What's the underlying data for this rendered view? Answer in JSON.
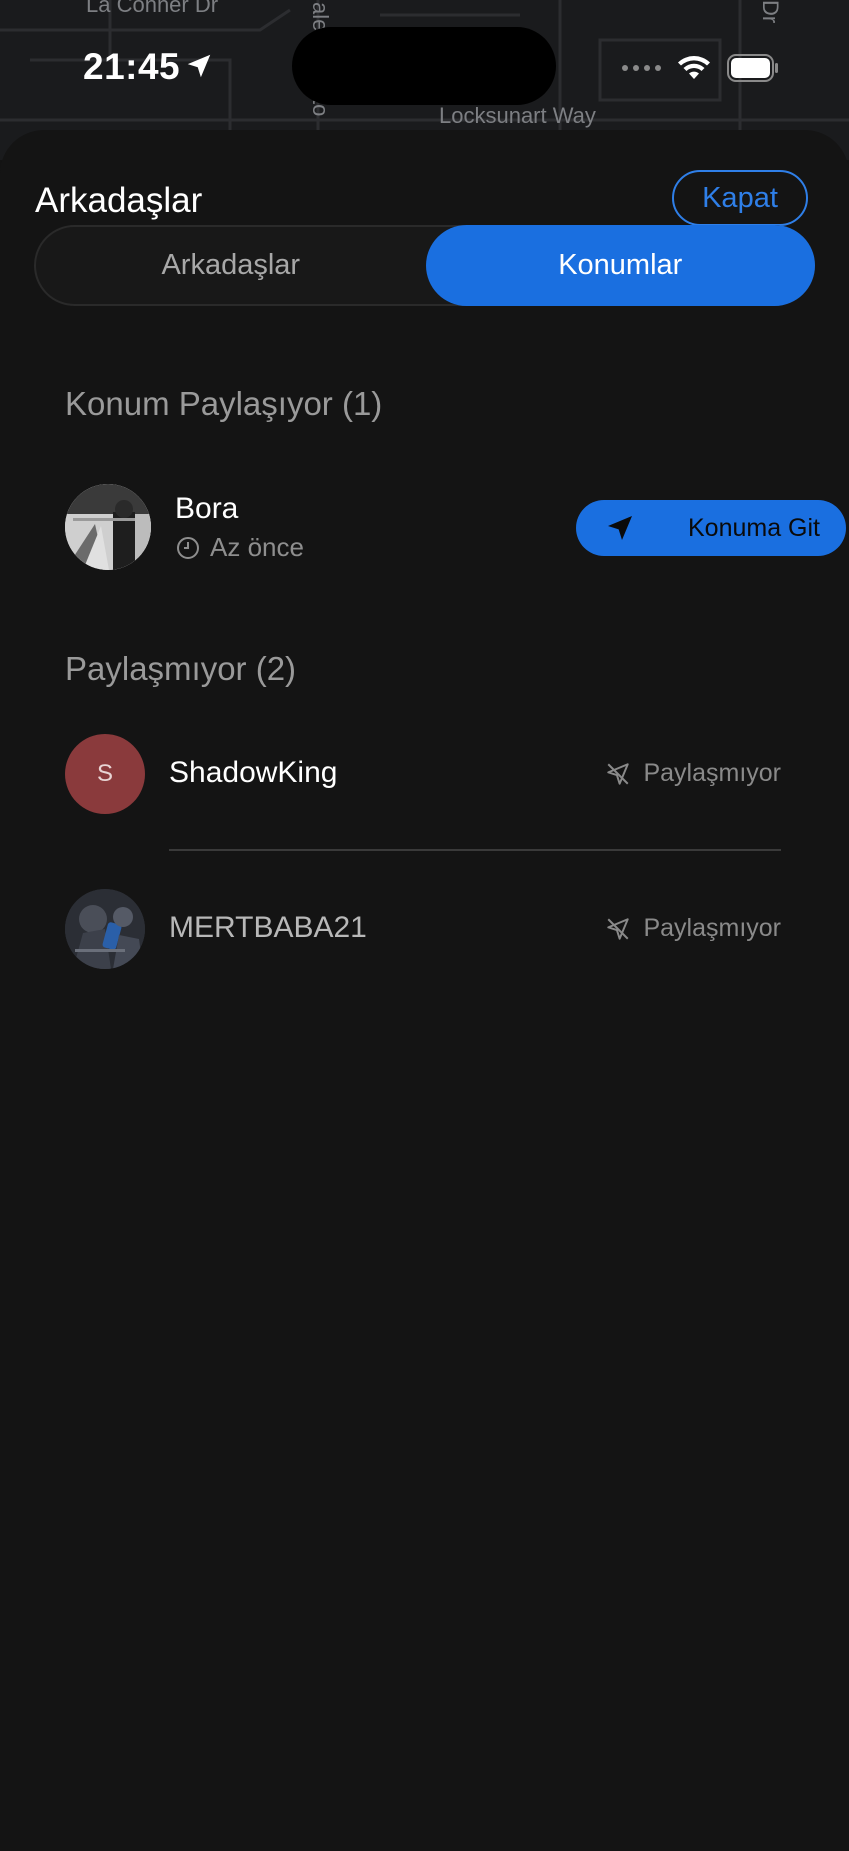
{
  "map": {
    "labels": {
      "top_left": "La Conner Dr",
      "bottom": "Locksunart Way",
      "vertical_1": "ale",
      "vertical_2": "to",
      "vertical_right": "Dr"
    }
  },
  "status_bar": {
    "time": "21:45",
    "location_icon": "location-arrow-icon",
    "cellular_icon": "cellular-dots-icon",
    "wifi_icon": "wifi-icon",
    "battery_icon": "battery-icon"
  },
  "sheet": {
    "title": "Arkadaşlar",
    "close_label": "Kapat",
    "tabs": [
      {
        "label": "Arkadaşlar",
        "active": false
      },
      {
        "label": "Konumlar",
        "active": true
      }
    ]
  },
  "sharing_section": {
    "header": "Konum Paylaşıyor (1)",
    "items": [
      {
        "name": "Bora",
        "last_seen": "Az önce",
        "clock_icon": "clock-icon",
        "action_label": "Konuma Git",
        "action_icon": "navigation-arrow-icon"
      }
    ]
  },
  "not_sharing_section": {
    "header": "Paylaşmıyor (2)",
    "items": [
      {
        "name": "ShadowKing",
        "initial": "S",
        "status": "Paylaşmıyor",
        "status_icon": "location-slash-icon"
      },
      {
        "name": "MERTBABA21",
        "status": "Paylaşmıyor",
        "status_icon": "location-slash-icon"
      }
    ]
  },
  "colors": {
    "accent": "#1a6fe0",
    "background": "#141414",
    "avatar_shadowking": "#8a3a3c"
  }
}
